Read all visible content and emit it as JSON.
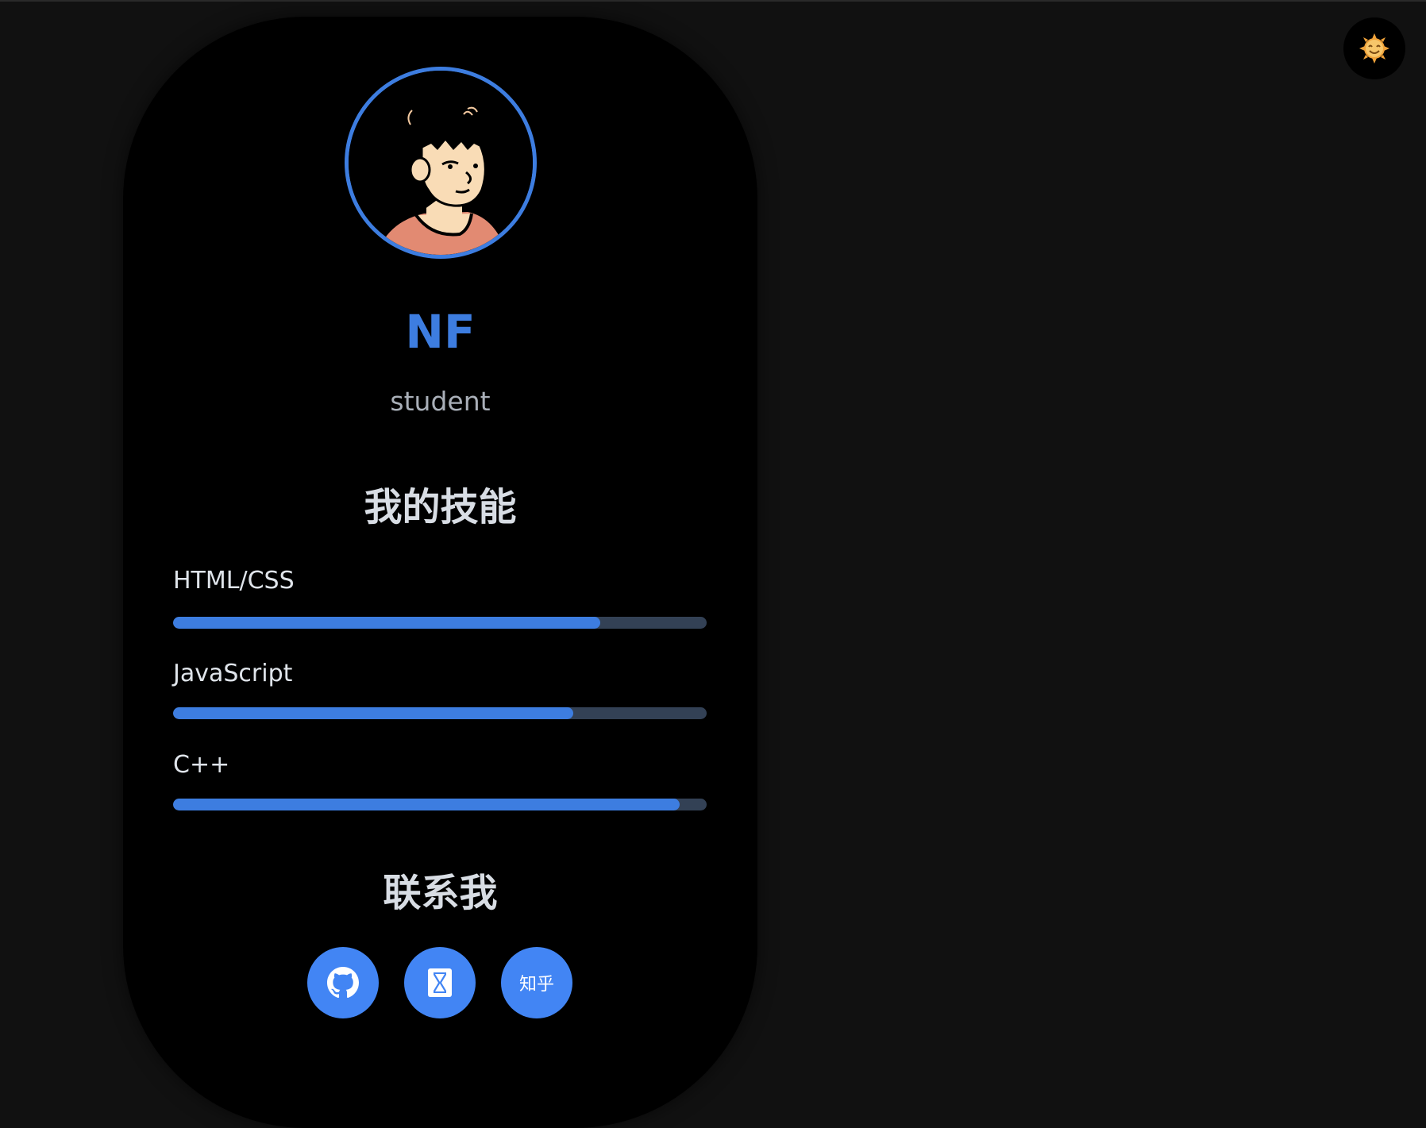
{
  "profile": {
    "name": "NF",
    "role": "student",
    "avatar_icon": "girl-avatar-illustration"
  },
  "skills": {
    "title": "我的技能",
    "items": [
      {
        "label": "HTML/CSS",
        "level": 0.8
      },
      {
        "label": "JavaScript",
        "level": 0.75
      },
      {
        "label": "C++",
        "level": 0.95
      }
    ]
  },
  "contact": {
    "title": "联系我",
    "links": [
      {
        "name": "github",
        "icon": "github-icon"
      },
      {
        "name": "csdn",
        "icon": "hourglass-icon"
      },
      {
        "name": "zhihu",
        "label": "知乎"
      }
    ]
  },
  "theme_toggle": {
    "icon": "sun-icon"
  },
  "colors": {
    "accent": "#3d7de0",
    "button": "#4285f4",
    "track": "#334155",
    "background": "#111111",
    "card": "#000000"
  }
}
